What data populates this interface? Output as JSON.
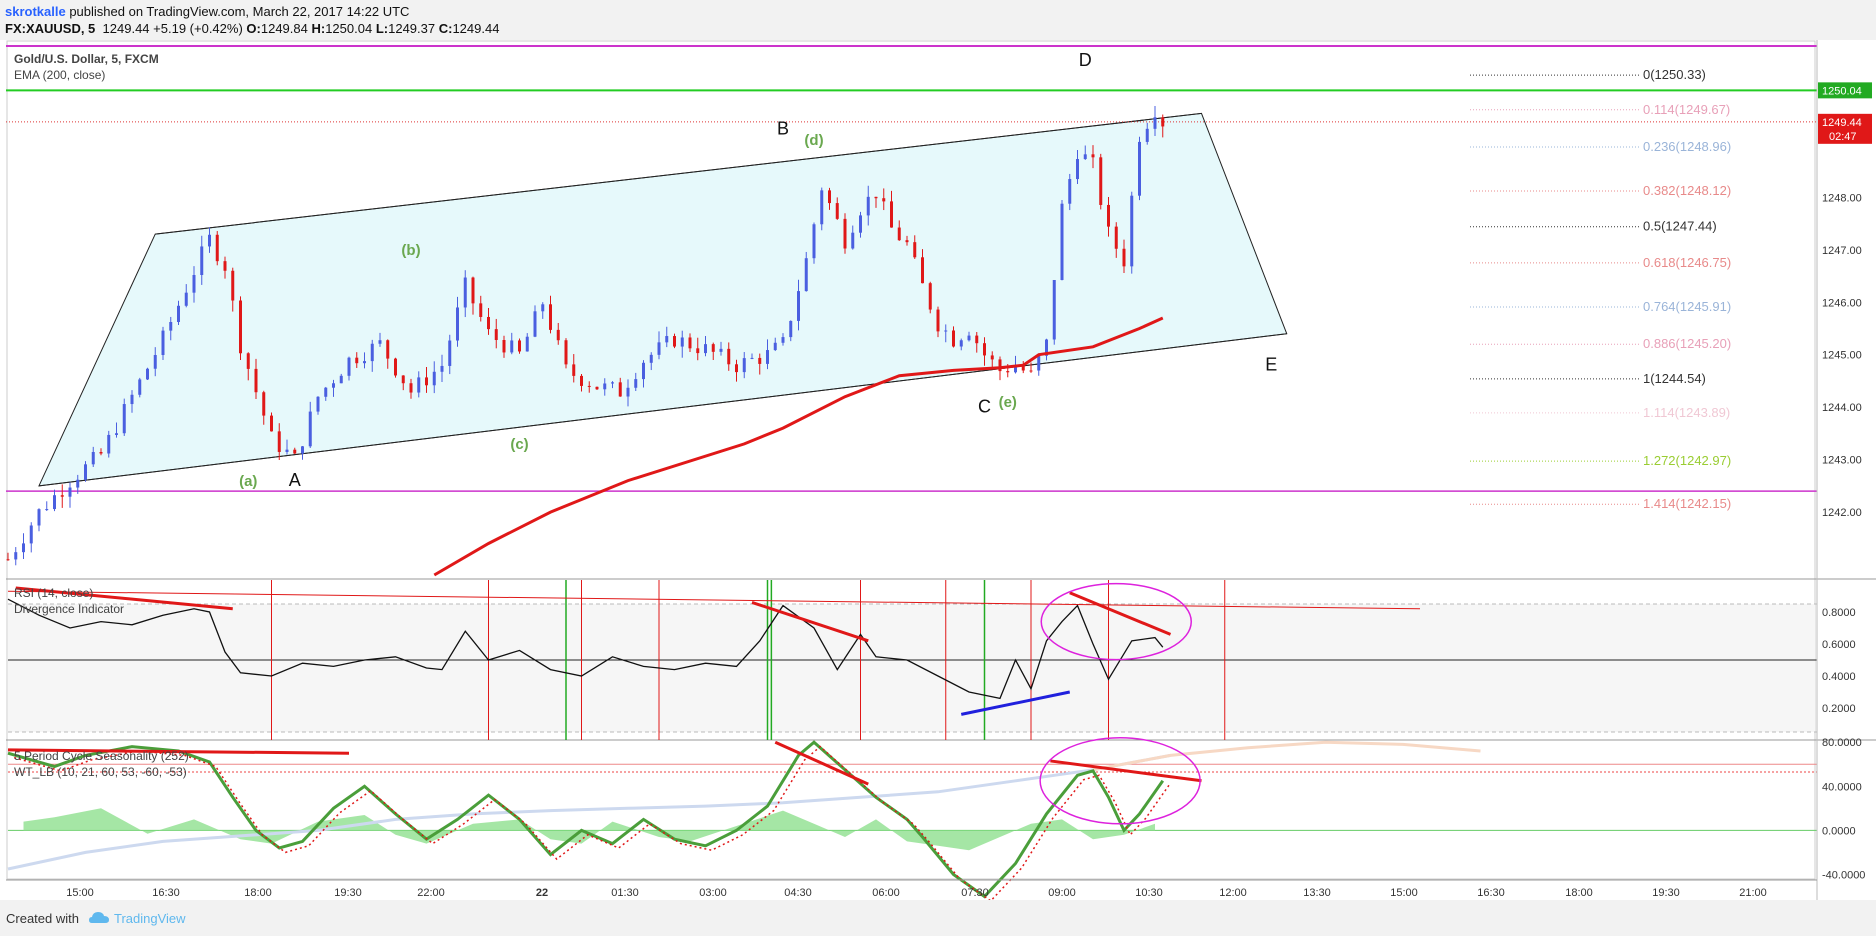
{
  "header": {
    "user": "skrotkalle",
    "published": " published on TradingView.com, March 22, 2017 14:22 UTC",
    "symbol": "FX:XAUUSD, 5",
    "price": "1249.44",
    "change": "+5.19 (+0.42%)",
    "o_label": "O:",
    "o": "1249.84",
    "h_label": "H:",
    "h": "1250.04",
    "l_label": "L:",
    "l": "1249.37",
    "c_label": "C:",
    "c": "1249.44"
  },
  "footer": {
    "created_with": "Created with",
    "brand": "TradingView"
  },
  "chart_data": {
    "type": "candlestick",
    "title": "Gold/U.S. Dollar, 5, FXCM",
    "study": "EMA (200, close)",
    "ylim": [
      1240.8,
      1251.0
    ],
    "y_ticks": [
      "1242.00",
      "1243.00",
      "1244.00",
      "1245.00",
      "1246.00",
      "1247.00",
      "1248.00"
    ],
    "x_ticks": [
      "15:00",
      "16:30",
      "18:00",
      "19:30",
      "22:00",
      "22",
      "01:30",
      "03:00",
      "04:30",
      "06:00",
      "07:30",
      "09:00",
      "10:30",
      "12:00",
      "13:30",
      "15:00",
      "16:30",
      "18:00",
      "19:30",
      "21:00"
    ],
    "price_tags": {
      "high": "1250.04",
      "last": "1249.44",
      "countdown": "02:47"
    },
    "candle_path": [
      [
        0,
        1241.1
      ],
      [
        4,
        1242.0
      ],
      [
        8,
        1242.6
      ],
      [
        12,
        1243.1
      ],
      [
        16,
        1244.2
      ],
      [
        20,
        1245.3
      ],
      [
        24,
        1246.6
      ],
      [
        26,
        1247.2
      ],
      [
        28,
        1246.7
      ],
      [
        30,
        1245.2
      ],
      [
        34,
        1243.4
      ],
      [
        37,
        1243.0
      ],
      [
        40,
        1244.2
      ],
      [
        44,
        1244.9
      ],
      [
        48,
        1245.2
      ],
      [
        52,
        1244.3
      ],
      [
        56,
        1244.8
      ],
      [
        59,
        1246.3
      ],
      [
        62,
        1245.4
      ],
      [
        66,
        1245.0
      ],
      [
        69,
        1246.0
      ],
      [
        72,
        1244.7
      ],
      [
        76,
        1244.4
      ],
      [
        79,
        1244.3
      ],
      [
        82,
        1244.9
      ],
      [
        86,
        1245.3
      ],
      [
        90,
        1245.1
      ],
      [
        94,
        1244.8
      ],
      [
        98,
        1245.0
      ],
      [
        100,
        1245.2
      ],
      [
        103,
        1246.8
      ],
      [
        105,
        1248.2
      ],
      [
        108,
        1247.2
      ],
      [
        110,
        1247.8
      ],
      [
        112,
        1248.1
      ],
      [
        114,
        1247.4
      ],
      [
        116,
        1247.1
      ],
      [
        118,
        1246.3
      ],
      [
        120,
        1245.6
      ],
      [
        122,
        1245.3
      ],
      [
        124,
        1245.5
      ],
      [
        126,
        1245.0
      ],
      [
        128,
        1244.7
      ],
      [
        130,
        1244.8
      ],
      [
        132,
        1244.6
      ],
      [
        134,
        1245.2
      ],
      [
        136,
        1247.8
      ],
      [
        138,
        1248.9
      ],
      [
        140,
        1248.6
      ],
      [
        142,
        1247.3
      ],
      [
        144,
        1246.8
      ],
      [
        146,
        1249.2
      ],
      [
        148,
        1249.7
      ],
      [
        149,
        1249.44
      ]
    ],
    "ema200": [
      [
        55,
        1240.8
      ],
      [
        62,
        1241.4
      ],
      [
        70,
        1242.0
      ],
      [
        80,
        1242.6
      ],
      [
        95,
        1243.3
      ],
      [
        100,
        1243.6
      ],
      [
        108,
        1244.2
      ],
      [
        115,
        1244.6
      ],
      [
        122,
        1244.7
      ],
      [
        128,
        1244.75
      ],
      [
        131,
        1244.8
      ],
      [
        133,
        1245.0
      ],
      [
        140,
        1245.15
      ],
      [
        146,
        1245.5
      ],
      [
        149,
        1245.7
      ]
    ],
    "channel": {
      "upper": [
        [
          19,
          1247.3
        ],
        [
          149,
          1249.5
        ],
        [
          154,
          1249.6
        ]
      ],
      "lower": [
        [
          4,
          1242.5
        ],
        [
          165,
          1245.4
        ]
      ]
    },
    "wave_labels": [
      {
        "text": "A",
        "x": 37,
        "y": 1242.5,
        "color": "#111111"
      },
      {
        "text": "(a)",
        "x": 31,
        "y": 1242.5,
        "color": "#6aa84f"
      },
      {
        "text": "(b)",
        "x": 52,
        "y": 1246.9,
        "color": "#6aa84f"
      },
      {
        "text": "(c)",
        "x": 66,
        "y": 1243.2,
        "color": "#6aa84f"
      },
      {
        "text": "B",
        "x": 100,
        "y": 1249.2,
        "color": "#111111"
      },
      {
        "text": "(d)",
        "x": 104,
        "y": 1249.0,
        "color": "#6aa84f"
      },
      {
        "text": "C",
        "x": 126,
        "y": 1243.9,
        "color": "#111111"
      },
      {
        "text": "(e)",
        "x": 129,
        "y": 1244.0,
        "color": "#6aa84f"
      },
      {
        "text": "D",
        "x": 139,
        "y": 1250.5,
        "color": "#111111"
      },
      {
        "text": "E",
        "x": 163,
        "y": 1244.7,
        "color": "#111111"
      }
    ],
    "fib_levels": [
      {
        "label": "0(1250.33)",
        "value": 1250.33,
        "color": "#333333"
      },
      {
        "label": "0.114(1249.67)",
        "value": 1249.67,
        "color": "#e8a0b8"
      },
      {
        "label": "0.236(1248.96)",
        "value": 1248.96,
        "color": "#9ab4d8"
      },
      {
        "label": "0.382(1248.12)",
        "value": 1248.12,
        "color": "#e88a8a"
      },
      {
        "label": "0.5(1247.44)",
        "value": 1247.44,
        "color": "#333333"
      },
      {
        "label": "0.618(1246.75)",
        "value": 1246.75,
        "color": "#e88a8a"
      },
      {
        "label": "0.764(1245.91)",
        "value": 1245.91,
        "color": "#9ab4d8"
      },
      {
        "label": "0.886(1245.20)",
        "value": 1245.2,
        "color": "#e8a0b8"
      },
      {
        "label": "1(1244.54)",
        "value": 1244.54,
        "color": "#333333"
      },
      {
        "label": "1.114(1243.89)",
        "value": 1243.89,
        "color": "#f0c8d4"
      },
      {
        "label": "1.272(1242.97)",
        "value": 1242.97,
        "color": "#9acd32"
      },
      {
        "label": "1.414(1242.15)",
        "value": 1242.15,
        "color": "#e88a8a"
      }
    ],
    "rsi": {
      "title": "RSI (14, close)",
      "subtitle": "Divergence Indicator",
      "ylim": [
        0.0,
        1.0
      ],
      "y_ticks": [
        "0.8000",
        "0.6000",
        "0.4000",
        "0.2000"
      ],
      "path": [
        [
          0,
          0.88
        ],
        [
          4,
          0.78
        ],
        [
          8,
          0.7
        ],
        [
          12,
          0.74
        ],
        [
          16,
          0.72
        ],
        [
          20,
          0.78
        ],
        [
          24,
          0.82
        ],
        [
          26,
          0.8
        ],
        [
          28,
          0.55
        ],
        [
          30,
          0.42
        ],
        [
          34,
          0.4
        ],
        [
          38,
          0.48
        ],
        [
          42,
          0.46
        ],
        [
          46,
          0.5
        ],
        [
          50,
          0.52
        ],
        [
          54,
          0.45
        ],
        [
          56,
          0.44
        ],
        [
          59,
          0.68
        ],
        [
          62,
          0.5
        ],
        [
          66,
          0.56
        ],
        [
          70,
          0.44
        ],
        [
          74,
          0.4
        ],
        [
          78,
          0.52
        ],
        [
          82,
          0.46
        ],
        [
          86,
          0.44
        ],
        [
          90,
          0.48
        ],
        [
          94,
          0.46
        ],
        [
          97,
          0.62
        ],
        [
          100,
          0.84
        ],
        [
          104,
          0.7
        ],
        [
          107,
          0.44
        ],
        [
          110,
          0.66
        ],
        [
          112,
          0.52
        ],
        [
          116,
          0.5
        ],
        [
          120,
          0.4
        ],
        [
          124,
          0.3
        ],
        [
          128,
          0.26
        ],
        [
          130,
          0.5
        ],
        [
          132,
          0.32
        ],
        [
          134,
          0.62
        ],
        [
          136,
          0.74
        ],
        [
          138,
          0.84
        ],
        [
          140,
          0.6
        ],
        [
          142,
          0.38
        ],
        [
          145,
          0.62
        ],
        [
          148,
          0.64
        ],
        [
          149,
          0.58
        ]
      ]
    },
    "cycle": {
      "title": "5 Period Cycle Seasonality (252)",
      "subtitle": "WT_LB (10, 21, 60, 53, -60, -53)",
      "ylim": [
        -45,
        82
      ],
      "y_ticks": [
        "80.0000",
        "40.0000",
        "0.0000",
        "-40.0000"
      ],
      "wt1": [
        [
          0,
          70
        ],
        [
          6,
          58
        ],
        [
          10,
          68
        ],
        [
          16,
          76
        ],
        [
          22,
          72
        ],
        [
          26,
          62
        ],
        [
          29,
          30
        ],
        [
          32,
          0
        ],
        [
          35,
          -16
        ],
        [
          38,
          -10
        ],
        [
          42,
          20
        ],
        [
          46,
          40
        ],
        [
          50,
          15
        ],
        [
          54,
          -8
        ],
        [
          58,
          10
        ],
        [
          62,
          32
        ],
        [
          66,
          10
        ],
        [
          70,
          -22
        ],
        [
          74,
          0
        ],
        [
          78,
          -12
        ],
        [
          82,
          10
        ],
        [
          86,
          -8
        ],
        [
          90,
          -14
        ],
        [
          94,
          0
        ],
        [
          98,
          22
        ],
        [
          102,
          68
        ],
        [
          104,
          80
        ],
        [
          108,
          55
        ],
        [
          112,
          30
        ],
        [
          116,
          10
        ],
        [
          118,
          -6
        ],
        [
          122,
          -40
        ],
        [
          126,
          -60
        ],
        [
          130,
          -30
        ],
        [
          134,
          15
        ],
        [
          138,
          50
        ],
        [
          140,
          54
        ],
        [
          142,
          30
        ],
        [
          144,
          0
        ],
        [
          146,
          15
        ],
        [
          149,
          45
        ]
      ],
      "season": [
        [
          0,
          -35
        ],
        [
          10,
          -20
        ],
        [
          20,
          -10
        ],
        [
          30,
          -5
        ],
        [
          40,
          0
        ],
        [
          50,
          10
        ],
        [
          60,
          15
        ],
        [
          70,
          18
        ],
        [
          80,
          20
        ],
        [
          90,
          22
        ],
        [
          100,
          25
        ],
        [
          110,
          30
        ],
        [
          120,
          35
        ],
        [
          130,
          45
        ],
        [
          140,
          55
        ],
        [
          150,
          68
        ],
        [
          160,
          75
        ],
        [
          170,
          80
        ],
        [
          180,
          78
        ],
        [
          190,
          72
        ]
      ],
      "hist": [
        [
          2,
          8
        ],
        [
          6,
          12
        ],
        [
          12,
          20
        ],
        [
          18,
          -3
        ],
        [
          24,
          10
        ],
        [
          30,
          -8
        ],
        [
          34,
          -12
        ],
        [
          40,
          8
        ],
        [
          46,
          14
        ],
        [
          50,
          -4
        ],
        [
          54,
          -12
        ],
        [
          60,
          6
        ],
        [
          66,
          10
        ],
        [
          70,
          -8
        ],
        [
          74,
          -12
        ],
        [
          78,
          8
        ],
        [
          84,
          -6
        ],
        [
          88,
          -10
        ],
        [
          94,
          4
        ],
        [
          100,
          18
        ],
        [
          104,
          6
        ],
        [
          108,
          -6
        ],
        [
          112,
          10
        ],
        [
          116,
          -10
        ],
        [
          120,
          -14
        ],
        [
          124,
          -18
        ],
        [
          128,
          -6
        ],
        [
          132,
          6
        ],
        [
          136,
          10
        ],
        [
          140,
          -8
        ],
        [
          144,
          -4
        ],
        [
          148,
          6
        ]
      ]
    }
  }
}
